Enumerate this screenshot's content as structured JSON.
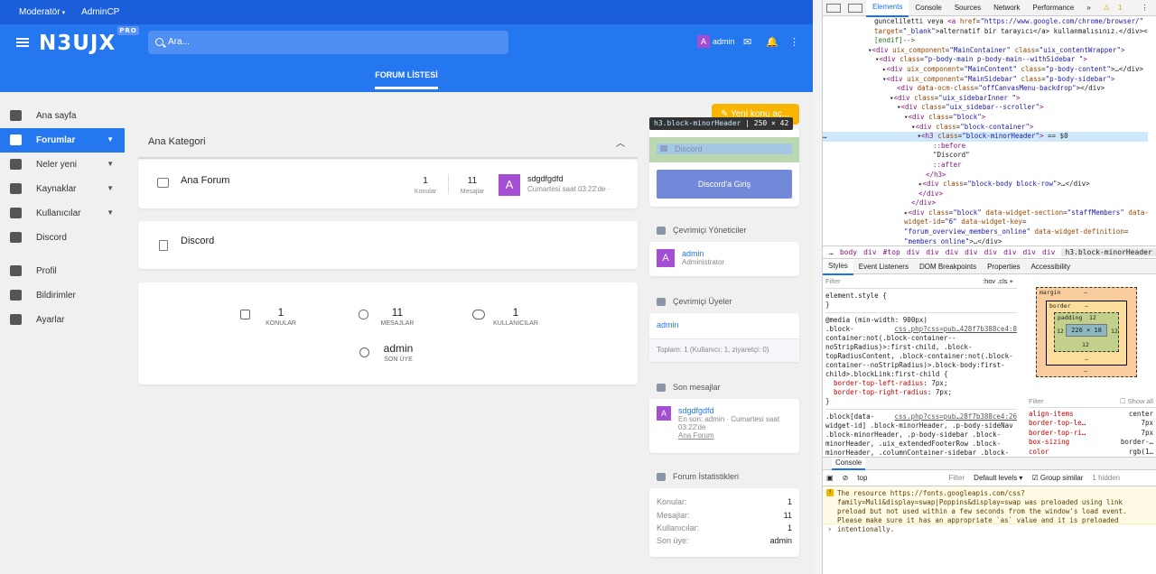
{
  "topbar": {
    "moderator": "Moderatör",
    "admincp": "AdminCP"
  },
  "header": {
    "logo": "N3UJX",
    "logo_badge": "PRO",
    "search_placeholder": "Ara...",
    "user": "admin",
    "avatar_letter": "A",
    "tab": "FORUM LİSTESİ"
  },
  "sidenav": [
    {
      "label": "Ana sayfa",
      "icon": "home-icon"
    },
    {
      "label": "Forumlar",
      "icon": "forum-icon",
      "active": true
    },
    {
      "label": "Neler yeni",
      "icon": "alert-icon"
    },
    {
      "label": "Kaynaklar",
      "icon": "box-icon"
    },
    {
      "label": "Kullanıcılar",
      "icon": "users-icon"
    },
    {
      "label": "Discord",
      "icon": "discord-icon"
    },
    {
      "label": "Profil",
      "icon": "person-icon"
    },
    {
      "label": "Bildirimler",
      "icon": "bell-icon"
    },
    {
      "label": "Ayarlar",
      "icon": "gear-icon"
    }
  ],
  "category": {
    "title": "Ana Kategori"
  },
  "forum1": {
    "name": "Ana Forum",
    "topics_n": "1",
    "topics_l": "Konular",
    "msgs_n": "11",
    "msgs_l": "Mesajlar",
    "last_title": "sdgdfgdfd",
    "last_meta": "Cumartesi saat 03:22'de ·",
    "avatar": "A"
  },
  "forum2": {
    "name": "Discord"
  },
  "stats": {
    "topics_n": "1",
    "topics_l": "KONULAR",
    "msgs_n": "11",
    "msgs_l": "MESAJLAR",
    "users_n": "1",
    "users_l": "KULLANICILAR",
    "latest_n": "admin",
    "latest_l": "SON ÜYE"
  },
  "right": {
    "new_thread": "✎ Yeni konu aç...",
    "tooltip_name": "h3.block-minorHeader",
    "tooltip_size": "250 × 42",
    "discord_header": "Discord",
    "discord_btn": "Discord'a Giriş",
    "staff_header": "Çevrimiçi Yöneticiler",
    "staff_name": "admin",
    "staff_role": "Administrator",
    "members_header": "Çevrimiçi Üyeler",
    "members_name": "admin",
    "members_total": "Toplam: 1 (Kullanıcı: 1, ziyaretçi: 0)",
    "posts_header": "Son mesajlar",
    "post_title": "sdgdfgdfd",
    "post_meta": "En son: admin · Cumartesi saat 03:22'de",
    "post_forum": "Ana Forum",
    "fstats_header": "Forum İstatistikleri",
    "fstats": [
      {
        "k": "Konular:",
        "v": "1"
      },
      {
        "k": "Mesajlar:",
        "v": "11"
      },
      {
        "k": "Kullanıcılar:",
        "v": "1"
      },
      {
        "k": "Son üye:",
        "v": "admin"
      }
    ]
  },
  "devtools": {
    "tabs": [
      "Elements",
      "Console",
      "Sources",
      "Network",
      "Performance"
    ],
    "warn_count": "1",
    "breadcrumbs": [
      "body",
      "div",
      "#top",
      "div",
      "div",
      "div",
      "div",
      "div",
      "div",
      "div",
      "div"
    ],
    "breadcrumb_last": "h3.block-minorHeader",
    "style_tabs": [
      "Styles",
      "Event Listeners",
      "DOM Breakpoints",
      "Properties",
      "Accessibility"
    ],
    "filter": "Filter",
    "hov": ":hov",
    "cls": ".cls",
    "box": {
      "margin": "margin",
      "border": "border",
      "padding": "padding",
      "pad_v": "12",
      "content": "226 × 18",
      "dash": "–"
    },
    "computed": [
      {
        "k": "align-items",
        "v": "center"
      },
      {
        "k": "border-top-le…",
        "v": "7px"
      },
      {
        "k": "border-top-ri…",
        "v": "7px"
      },
      {
        "k": "box-sizing",
        "v": "border-…"
      },
      {
        "k": "color",
        "v": "rgb(1…"
      }
    ],
    "show_all": "Show all",
    "console_tab": "Console",
    "context": "top",
    "levels": "Default levels ▾",
    "group_similar": "Group similar",
    "hidden": "1 hidden",
    "warning": "The resource https://fonts.googleapis.com/css?family=Muli&display=swap|Poppins&display=swap was preloaded using link preload but not used within a few seconds from the window's load event. Please make sure it has an appropriate `as` value and it is preloaded intentionally."
  }
}
